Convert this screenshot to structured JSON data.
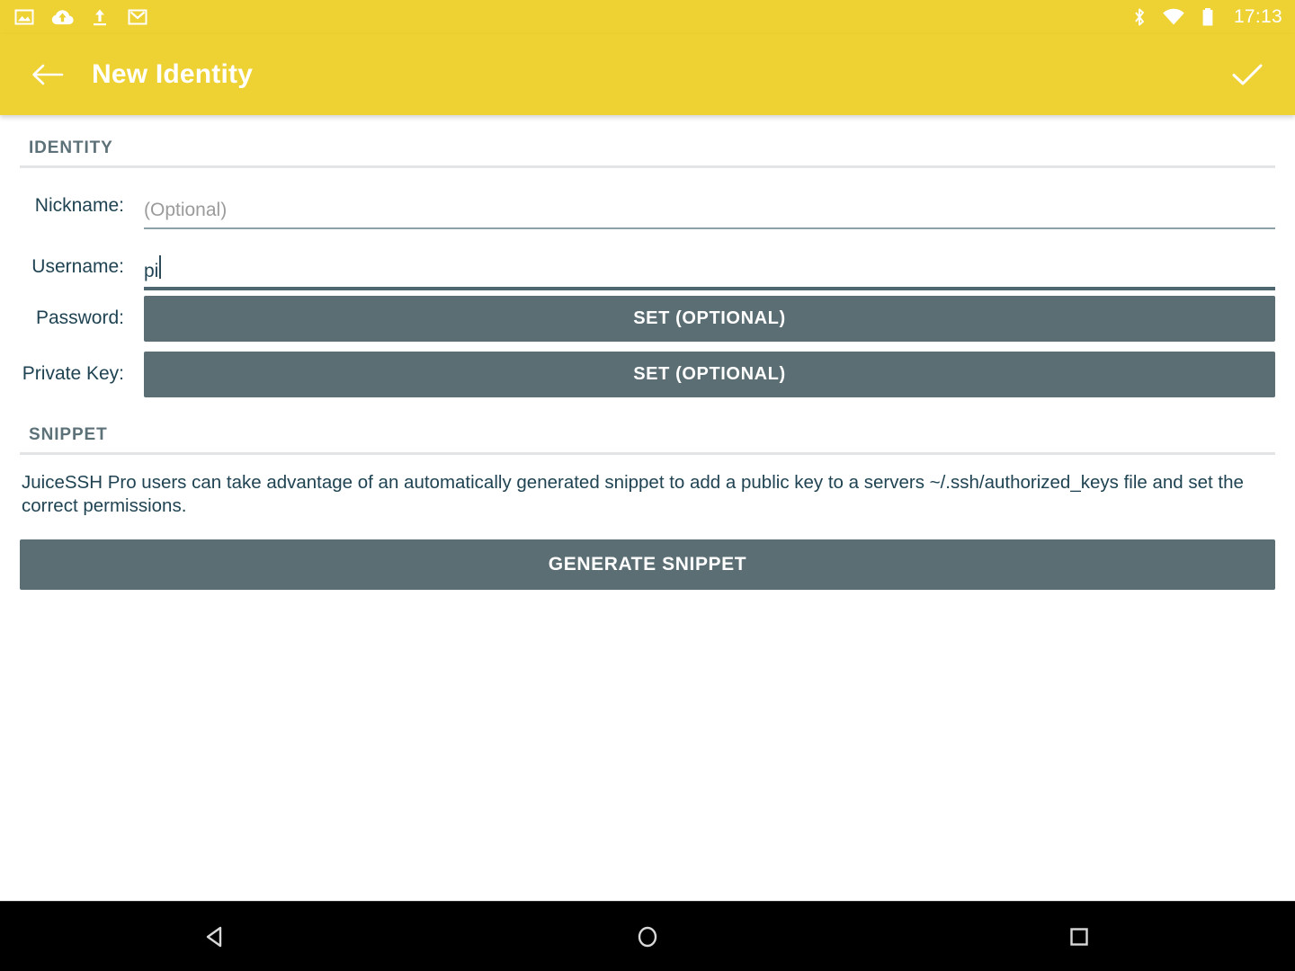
{
  "status_bar": {
    "icons": [
      "image-icon",
      "cloud-upload-icon",
      "upload-icon",
      "gmail-icon"
    ],
    "right_icons": [
      "bluetooth-icon",
      "wifi-icon",
      "battery-icon"
    ],
    "clock": "17:13"
  },
  "toolbar": {
    "back_icon": "back-arrow-icon",
    "title": "New Identity",
    "confirm_icon": "check-icon",
    "background_color": "#eed132",
    "text_color": "#ffffff"
  },
  "sections": {
    "identity": {
      "header": "IDENTITY",
      "fields": {
        "nickname": {
          "label": "Nickname:",
          "value": "",
          "placeholder": "(Optional)",
          "focused": false
        },
        "username": {
          "label": "Username:",
          "value": "pi",
          "placeholder": "",
          "focused": true
        },
        "password": {
          "label": "Password:",
          "button_label": "SET (OPTIONAL)"
        },
        "private_key": {
          "label": "Private Key:",
          "button_label": "SET (OPTIONAL)"
        }
      }
    },
    "snippet": {
      "header": "SNIPPET",
      "description": "JuiceSSH Pro users can take advantage of an automatically generated snippet to add a public key to a servers ~/.ssh/authorized_keys file and set the correct permissions.",
      "generate_label": "GENERATE SNIPPET"
    }
  },
  "nav_bar": {
    "back_icon": "nav-back-icon",
    "home_icon": "nav-home-icon",
    "recents_icon": "nav-recents-icon"
  },
  "colors": {
    "accent": "#eed132",
    "button": "#5b6e74",
    "text": "#1f4352",
    "section_header": "#5d7178",
    "placeholder": "#9b9b9b"
  }
}
